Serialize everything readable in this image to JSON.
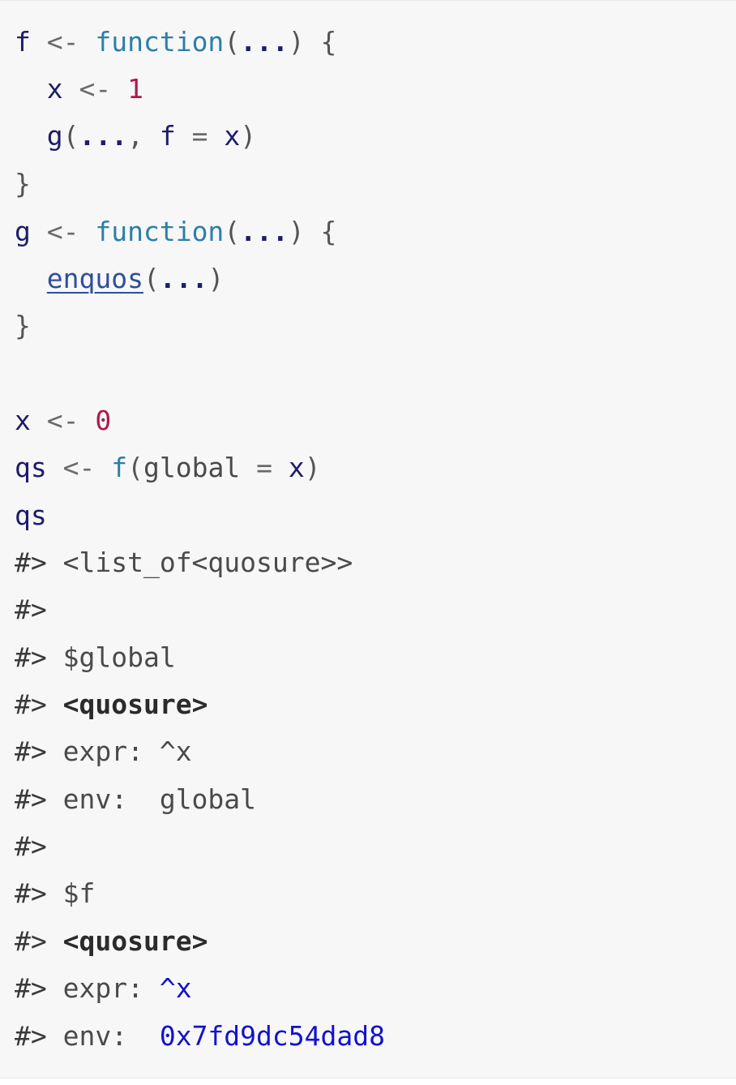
{
  "code_lines": [
    {
      "tokens": [
        {
          "text": "f",
          "cls": "tok-var"
        },
        {
          "text": " <- ",
          "cls": "tok-op"
        },
        {
          "text": "function",
          "cls": "tok-fn"
        },
        {
          "text": "(",
          "cls": "tok-punc"
        },
        {
          "text": "...",
          "cls": "tok-dots"
        },
        {
          "text": ") {",
          "cls": "tok-punc"
        }
      ]
    },
    {
      "tokens": [
        {
          "text": "  x",
          "cls": "tok-var"
        },
        {
          "text": " <- ",
          "cls": "tok-op"
        },
        {
          "text": "1",
          "cls": "tok-num"
        }
      ]
    },
    {
      "tokens": [
        {
          "text": "  g",
          "cls": "tok-call"
        },
        {
          "text": "(",
          "cls": "tok-punc"
        },
        {
          "text": "...",
          "cls": "tok-dots"
        },
        {
          "text": ", ",
          "cls": "tok-punc"
        },
        {
          "text": "f",
          "cls": "tok-var"
        },
        {
          "text": " = ",
          "cls": "tok-op"
        },
        {
          "text": "x",
          "cls": "tok-var"
        },
        {
          "text": ")",
          "cls": "tok-punc"
        }
      ]
    },
    {
      "tokens": [
        {
          "text": "}",
          "cls": "tok-punc"
        }
      ]
    },
    {
      "tokens": [
        {
          "text": "g",
          "cls": "tok-var"
        },
        {
          "text": " <- ",
          "cls": "tok-op"
        },
        {
          "text": "function",
          "cls": "tok-fn"
        },
        {
          "text": "(",
          "cls": "tok-punc"
        },
        {
          "text": "...",
          "cls": "tok-dots"
        },
        {
          "text": ") {",
          "cls": "tok-punc"
        }
      ]
    },
    {
      "tokens": [
        {
          "text": "  ",
          "cls": "tok-plain"
        },
        {
          "text": "enquos",
          "cls": "tok-link"
        },
        {
          "text": "(",
          "cls": "tok-punc"
        },
        {
          "text": "...",
          "cls": "tok-dots"
        },
        {
          "text": ")",
          "cls": "tok-punc"
        }
      ]
    },
    {
      "tokens": [
        {
          "text": "}",
          "cls": "tok-punc"
        }
      ]
    },
    {
      "tokens": []
    },
    {
      "tokens": [
        {
          "text": "x",
          "cls": "tok-var"
        },
        {
          "text": " <- ",
          "cls": "tok-op"
        },
        {
          "text": "0",
          "cls": "tok-num"
        }
      ]
    },
    {
      "tokens": [
        {
          "text": "qs",
          "cls": "tok-var"
        },
        {
          "text": " <- ",
          "cls": "tok-op"
        },
        {
          "text": "f",
          "cls": "tok-fn"
        },
        {
          "text": "(",
          "cls": "tok-punc"
        },
        {
          "text": "global",
          "cls": "tok-out"
        },
        {
          "text": " = ",
          "cls": "tok-op"
        },
        {
          "text": "x",
          "cls": "tok-var"
        },
        {
          "text": ")",
          "cls": "tok-punc"
        }
      ]
    },
    {
      "tokens": [
        {
          "text": "qs",
          "cls": "tok-var"
        }
      ]
    },
    {
      "tokens": [
        {
          "text": "#>",
          "cls": "tok-prompt"
        },
        {
          "text": " <list_of<quosure>>",
          "cls": "tok-out"
        }
      ]
    },
    {
      "tokens": [
        {
          "text": "#>",
          "cls": "tok-prompt"
        }
      ]
    },
    {
      "tokens": [
        {
          "text": "#>",
          "cls": "tok-prompt"
        },
        {
          "text": " $global",
          "cls": "tok-out"
        }
      ]
    },
    {
      "tokens": [
        {
          "text": "#>",
          "cls": "tok-prompt"
        },
        {
          "text": " ",
          "cls": "tok-out"
        },
        {
          "text": "<quosure>",
          "cls": "tok-bold"
        }
      ]
    },
    {
      "tokens": [
        {
          "text": "#>",
          "cls": "tok-prompt"
        },
        {
          "text": " expr: ^x",
          "cls": "tok-out"
        }
      ]
    },
    {
      "tokens": [
        {
          "text": "#>",
          "cls": "tok-prompt"
        },
        {
          "text": " env:  global",
          "cls": "tok-out"
        }
      ]
    },
    {
      "tokens": [
        {
          "text": "#>",
          "cls": "tok-prompt"
        }
      ]
    },
    {
      "tokens": [
        {
          "text": "#>",
          "cls": "tok-prompt"
        },
        {
          "text": " $f",
          "cls": "tok-out"
        }
      ]
    },
    {
      "tokens": [
        {
          "text": "#>",
          "cls": "tok-prompt"
        },
        {
          "text": " ",
          "cls": "tok-out"
        },
        {
          "text": "<quosure>",
          "cls": "tok-bold"
        }
      ]
    },
    {
      "tokens": [
        {
          "text": "#>",
          "cls": "tok-prompt"
        },
        {
          "text": " expr: ",
          "cls": "tok-out"
        },
        {
          "text": "^x",
          "cls": "tok-blue"
        }
      ]
    },
    {
      "tokens": [
        {
          "text": "#>",
          "cls": "tok-prompt"
        },
        {
          "text": " env:  ",
          "cls": "tok-out"
        },
        {
          "text": "0x7fd9dc54dad8",
          "cls": "tok-blue"
        }
      ]
    }
  ]
}
